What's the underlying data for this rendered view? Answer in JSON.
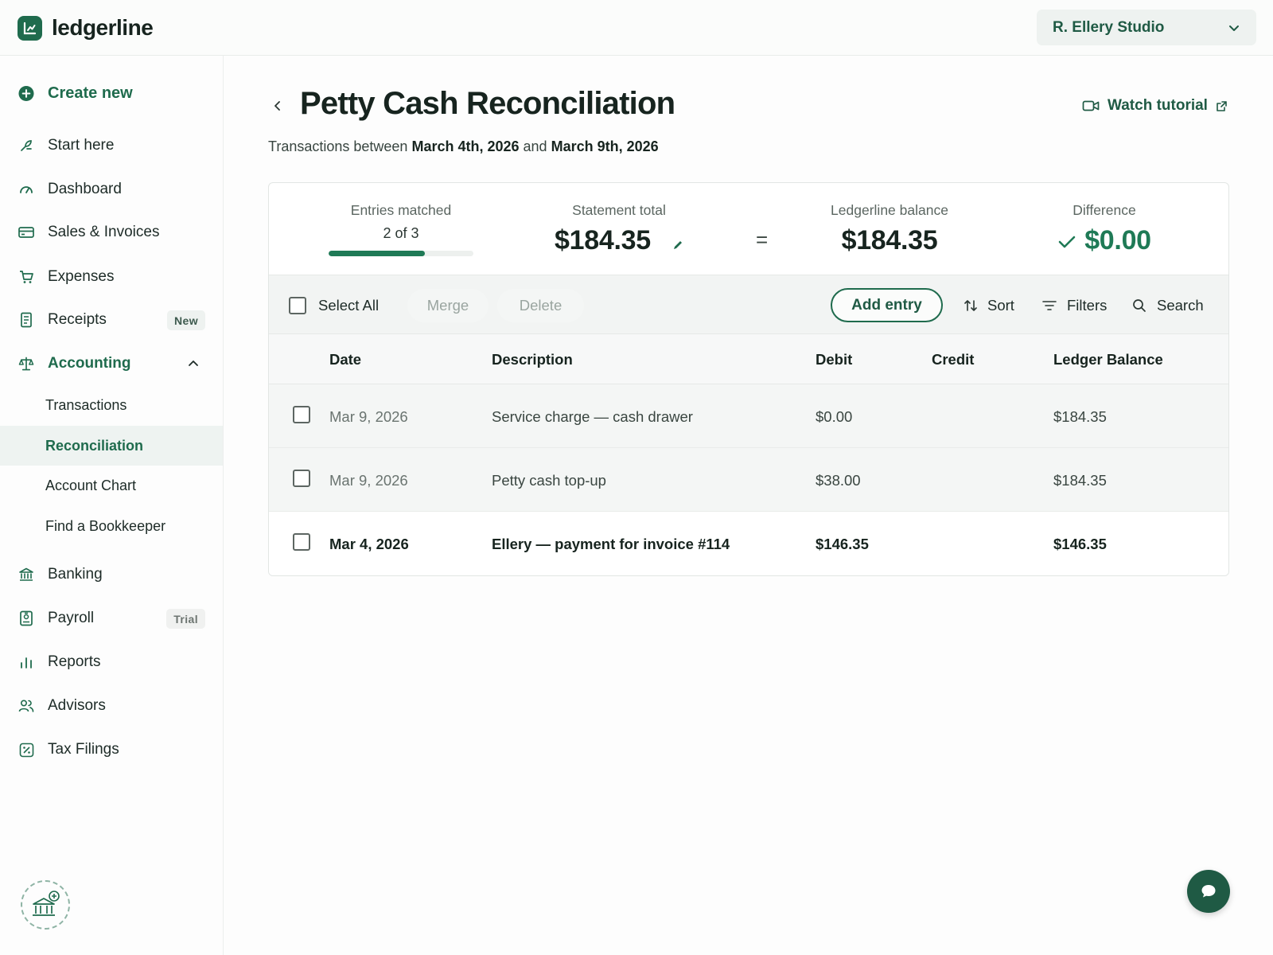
{
  "brand": {
    "name": "ledgerline"
  },
  "org_switcher": {
    "label": "R. Ellery Studio"
  },
  "sidebar": {
    "create": "Create new",
    "items": [
      {
        "label": "Start here",
        "icon": "leaf-pen-icon"
      },
      {
        "label": "Dashboard",
        "icon": "gauge-icon"
      },
      {
        "label": "Sales & Invoices",
        "icon": "card-icon"
      },
      {
        "label": "Expenses",
        "icon": "cart-icon"
      },
      {
        "label": "Receipts",
        "icon": "receipt-icon",
        "badge": "New"
      },
      {
        "label": "Accounting",
        "icon": "scale-icon"
      },
      {
        "label": "Transactions"
      },
      {
        "label": "Reconciliation"
      },
      {
        "label": "Account Chart"
      },
      {
        "label": "Find a Bookkeeper"
      },
      {
        "label": "Banking",
        "icon": "bank-icon"
      },
      {
        "label": "Payroll",
        "icon": "payroll-icon",
        "badge": "Trial"
      },
      {
        "label": "Reports",
        "icon": "bar-chart-icon"
      },
      {
        "label": "Advisors",
        "icon": "people-icon"
      },
      {
        "label": "Tax Filings",
        "icon": "percent-icon"
      }
    ]
  },
  "page": {
    "title": "Petty Cash Reconciliation",
    "tutorial": "Watch tutorial",
    "subtitle_prefix": "Transactions between",
    "start_date": "March 4th, 2026",
    "subtitle_mid": "and",
    "end_date": "March 9th, 2026"
  },
  "summary": {
    "matched_caption": "Entries matched",
    "matched_text": "2 of 3",
    "matched_fraction": 0.6667,
    "statement_caption": "Statement total",
    "statement_value": "$184.35",
    "equals": "=",
    "ledger_caption": "Ledgerline balance",
    "ledger_value": "$184.35",
    "difference_caption": "Difference",
    "difference_value": "$0.00"
  },
  "toolbar": {
    "select_all": "Select All",
    "merge": "Merge",
    "delete": "Delete",
    "add_entry": "Add entry",
    "sort": "Sort",
    "filters": "Filters",
    "search": "Search"
  },
  "table": {
    "headers": {
      "date": "Date",
      "description": "Description",
      "debit": "Debit",
      "credit": "Credit",
      "balance": "Ledger Balance"
    },
    "rows": [
      {
        "date": "Mar 9, 2026",
        "description": "Service charge — cash drawer",
        "debit": "$0.00",
        "credit": "",
        "balance": "$184.35"
      },
      {
        "date": "Mar 9, 2026",
        "description": "Petty cash top-up",
        "debit": "$38.00",
        "credit": "",
        "balance": "$184.35"
      },
      {
        "date": "Mar 4, 2026",
        "description": "Ellery — payment for invoice #114",
        "debit": "$146.35",
        "credit": "",
        "balance": "$146.35"
      }
    ]
  },
  "colors": {
    "brand": "#1f6b4d",
    "brand_dark": "#1f5a44",
    "success": "#1f7a56"
  }
}
